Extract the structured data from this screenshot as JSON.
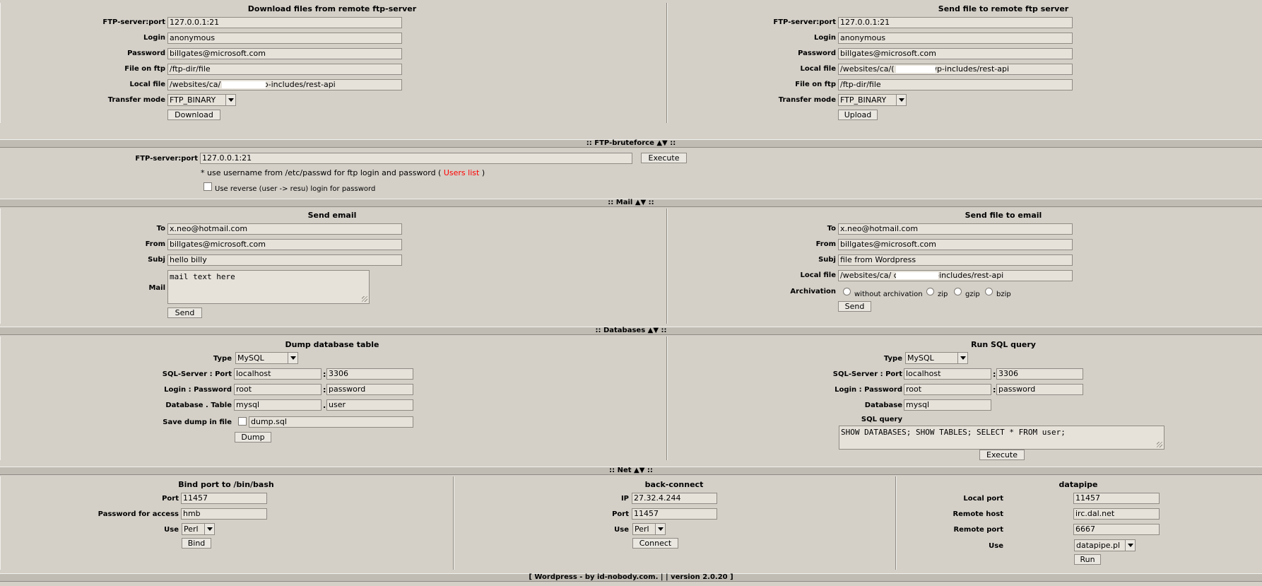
{
  "ftp": {
    "download": {
      "title": "Download files from remote ftp-server",
      "server_label": "FTP-server:port",
      "server": "127.0.0.1:21",
      "login_label": "Login",
      "login": "anonymous",
      "password_label": "Password",
      "password": "billgates@microsoft.com",
      "remote_label": "File on ftp",
      "remote": "/ftp-dir/file",
      "local_label": "Local file",
      "local": "/websites/ca/                .com.au/wp-includes/rest-api",
      "mode_label": "Transfer mode",
      "mode": "FTP_BINARY",
      "button": "Download"
    },
    "upload": {
      "title": "Send file to remote ftp server",
      "server_label": "FTP-server:port",
      "server": "127.0.0.1:21",
      "login_label": "Login",
      "login": "anonymous",
      "password_label": "Password",
      "password": "billgates@microsoft.com",
      "local_label": "Local file",
      "local": "/websites/ca/(                  .com.au/wp-includes/rest-api",
      "remote_label": "File on ftp",
      "remote": "/ftp-dir/file",
      "mode_label": "Transfer mode",
      "mode": "FTP_BINARY",
      "button": "Upload"
    }
  },
  "bruteforce": {
    "header": ":: FTP-bruteforce ▲▼ ::",
    "server_label": "FTP-server:port",
    "server": "127.0.0.1:21",
    "button": "Execute",
    "note_prefix": "* use username from /etc/passwd for ftp login and password (",
    "note_link": "Users list",
    "note_suffix": ")",
    "reverse_label": "Use reverse (user -> resu) login for password"
  },
  "mail": {
    "header": ":: Mail ▲▼ ::",
    "send": {
      "title": "Send email",
      "to_label": "To",
      "to": "x.neo@hotmail.com",
      "from_label": "From",
      "from": "billgates@microsoft.com",
      "subj_label": "Subj",
      "subj": "hello billy",
      "mail_label": "Mail",
      "mail": "mail text here",
      "button": "Send"
    },
    "file": {
      "title": "Send file to email",
      "to_label": "To",
      "to": "x.neo@hotmail.com",
      "from_label": "From",
      "from": "billgates@microsoft.com",
      "subj_label": "Subj",
      "subj": "file from Wordpress",
      "local_label": "Local file",
      "local": "/websites/ca/                   com.au/wp-includes/rest-api",
      "arch_label": "Archivation",
      "opt_none": "without archivation",
      "opt_zip": "zip",
      "opt_gzip": "gzip",
      "opt_bzip": "bzip",
      "button": "Send"
    }
  },
  "db": {
    "header": ":: Databases ▲▼ ::",
    "dump": {
      "title": "Dump database table",
      "type_label": "Type",
      "type": "MySQL",
      "server_label": "SQL-Server : Port",
      "server": "localhost",
      "sep1": ":",
      "port": "3306",
      "login_label": "Login : Password",
      "login": "root",
      "sep2": ":",
      "password": "password",
      "table_label": "Database . Table",
      "database": "mysql",
      "sep3": ".",
      "table": "user",
      "save_label": "Save dump in file",
      "file": "dump.sql",
      "button": "Dump"
    },
    "query": {
      "title": "Run SQL query",
      "type_label": "Type",
      "type": "MySQL",
      "server_label": "SQL-Server : Port",
      "server": "localhost",
      "sep1": ":",
      "port": "3306",
      "login_label": "Login : Password",
      "login": "root",
      "sep2": ":",
      "password": "password",
      "db_label": "Database",
      "database": "mysql",
      "query_label": "SQL query",
      "query": "SHOW DATABASES; SHOW TABLES; SELECT * FROM user;",
      "button": "Execute"
    }
  },
  "net": {
    "header": ":: Net ▲▼ ::",
    "bind": {
      "title": "Bind port to /bin/bash",
      "port_label": "Port",
      "port": "11457",
      "pass_label": "Password for access",
      "pass": "hmb",
      "use_label": "Use",
      "use": "Perl",
      "button": "Bind"
    },
    "back": {
      "title": "back-connect",
      "ip_label": "IP",
      "ip": "27.32.4.244",
      "port_label": "Port",
      "port": "11457",
      "use_label": "Use",
      "use": "Perl",
      "button": "Connect"
    },
    "pipe": {
      "title": "datapipe",
      "lport_label": "Local port",
      "lport": "11457",
      "rhost_label": "Remote host",
      "rhost": "irc.dal.net",
      "rport_label": "Remote port",
      "rport": "6667",
      "use_label": "Use",
      "use": "datapipe.pl",
      "button": "Run"
    }
  },
  "footer": "[ Wordpress - by id-nobody.com. | | version 2.0.20 ]",
  "icons": {
    "sort": "sort-arrows-icon",
    "dropdown": "chevron-down-icon",
    "resize": "resize-grip-icon"
  },
  "colors": {
    "background": "#d4d0c8",
    "link": "#ff0000"
  }
}
